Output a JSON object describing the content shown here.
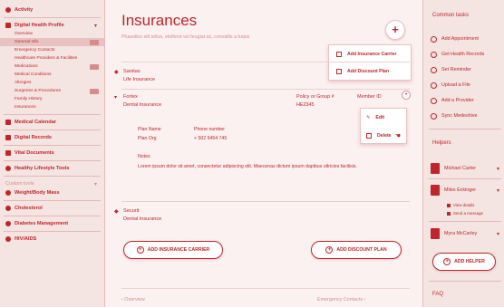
{
  "colors": {
    "accent": "#c0252a",
    "muted": "#d98a8b",
    "bg": "#fbf1f0"
  },
  "sidebar": {
    "activity": "Activity",
    "profile": "Digital Health Profile",
    "profile_items": [
      "Overview",
      "General Info",
      "Emergency Contacts",
      "Healthcare Providers & Facilities",
      "Medications",
      "Medical Conditions",
      "Allergies",
      "Surgeries & Procedures",
      "Family History",
      "Insurances"
    ],
    "main_items": [
      "Medical Calendar",
      "Digital Records",
      "Vital Documents",
      "Healthy Lifestyle Tools"
    ],
    "custom_section": "Custom tools",
    "custom_items": [
      "Weight/Body Mass",
      "Cholesterol",
      "Diabetes Management",
      "HIV/AIDS"
    ]
  },
  "main": {
    "title": "Insurances",
    "subtitle": "Phasellus elit tellus, eleifend vel feugiat ac, convallis a turpis",
    "add_menu": [
      "Add Insurance Carrier",
      "Add Discount Plan"
    ],
    "entries": [
      {
        "name": "Sanitas",
        "type": "Life Insurance"
      },
      {
        "name": "Fortex",
        "type": "Dental Insurance"
      },
      {
        "name": "Securit",
        "type": "Dental Insurance"
      }
    ],
    "fortex": {
      "policy_label": "Policy or Group #",
      "policy_value": "HE2345",
      "member_label": "Member ID",
      "plan_name_label": "Plan Name",
      "plan_org_label": "Plan Org",
      "phone_label": "Phone number",
      "phone_value": "+ 502 5454 745",
      "notes_label": "Notes",
      "notes_text": "Lorem ipsum dolor sit amet, consectetur adipiscing elit. Maecenas dictum ipsum dapibus ultricies facilisis."
    },
    "row_menu": [
      "Edit",
      "Delete"
    ],
    "add_carrier_button": "ADD INSURANCE CARRIER",
    "add_discount_button": "ADD DISCOUNT PLAN",
    "prev_nav": "Overview",
    "next_nav": "Emergency Contacts"
  },
  "right": {
    "common_title": "Common tasks",
    "tasks": [
      "Add Appointment",
      "Get Health Records",
      "Set Reminder",
      "Upload a File",
      "Add a Provider",
      "Sync Medeshive"
    ],
    "helpers_title": "Helpers",
    "helpers": [
      "Michael Carter",
      "Miles Eckinger",
      "Myra McCarley"
    ],
    "helper_actions": [
      "View details",
      "Send a message"
    ],
    "add_helper": "ADD HELPER",
    "faq": "FAQ"
  }
}
